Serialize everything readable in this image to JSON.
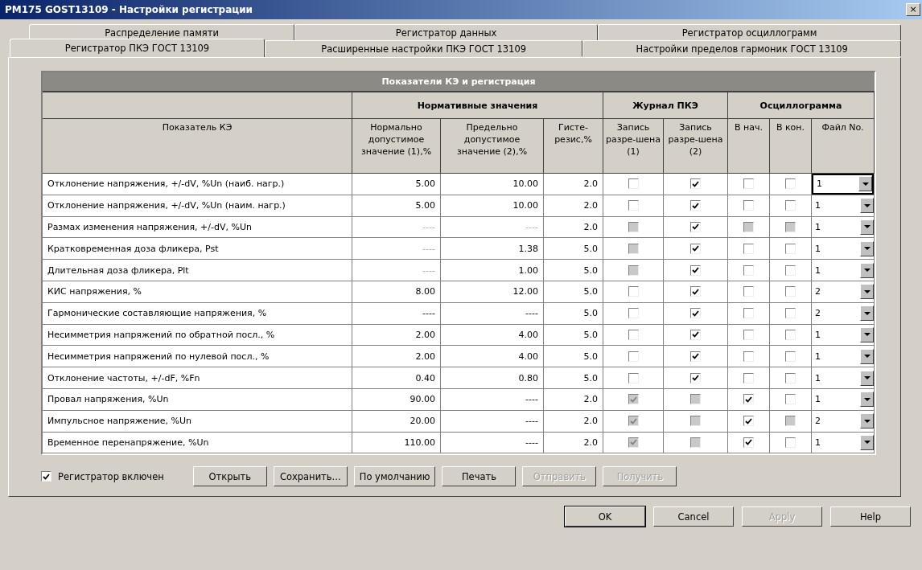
{
  "window": {
    "title": "PM175 GOST13109 - Настройки регистрации",
    "close": "×"
  },
  "tabs_back": [
    {
      "label": "Распределение памяти",
      "selected": false
    },
    {
      "label": "Регистратор данных",
      "selected": false
    },
    {
      "label": "Регистратор осциллограмм",
      "selected": false
    }
  ],
  "tabs_front": [
    {
      "label": "Регистратор ПКЭ ГОСТ 13109",
      "selected": true
    },
    {
      "label": "Расширенные настройки ПКЭ ГОСТ 13109",
      "selected": false
    },
    {
      "label": "Настройки пределов гармоник ГОСТ 13109",
      "selected": false
    }
  ],
  "table": {
    "title": "Показатели КЭ и регистрация",
    "groups": [
      "Нормативные значения",
      "Журнал ПКЭ",
      "Осциллограмма"
    ],
    "columns": [
      "Показатель КЭ",
      "Нормально допустимое значение (1),%",
      "Предельно допустимое значение (2),%",
      "Гисте-резис,%",
      "Запись разре-шена (1)",
      "Запись разре-шена (2)",
      "В нач.",
      "В кон.",
      "Файл No."
    ],
    "rows": [
      {
        "name": "Отклонение напряжения, +/-dV, %Un (наиб. нагр.)",
        "normal": {
          "text": "5.00",
          "disabled": false
        },
        "limit": {
          "text": "10.00",
          "disabled": false
        },
        "hyst": "2.0",
        "checks": [
          {
            "checked": false,
            "disabled": false
          },
          {
            "checked": true,
            "disabled": false
          },
          {
            "checked": false,
            "disabled": false
          },
          {
            "checked": false,
            "disabled": false
          }
        ],
        "file": "1",
        "focused": true
      },
      {
        "name": "Отклонение напряжения, +/-dV, %Un (наим. нагр.)",
        "normal": {
          "text": "5.00",
          "disabled": false
        },
        "limit": {
          "text": "10.00",
          "disabled": false
        },
        "hyst": "2.0",
        "checks": [
          {
            "checked": false,
            "disabled": false
          },
          {
            "checked": true,
            "disabled": false
          },
          {
            "checked": false,
            "disabled": false
          },
          {
            "checked": false,
            "disabled": false
          }
        ],
        "file": "1",
        "focused": false
      },
      {
        "name": "Размах изменения напряжения, +/-dV, %Un",
        "normal": {
          "text": "----",
          "disabled": true
        },
        "limit": {
          "text": "----",
          "disabled": true
        },
        "hyst": "2.0",
        "checks": [
          {
            "checked": false,
            "disabled": true
          },
          {
            "checked": true,
            "disabled": false
          },
          {
            "checked": false,
            "disabled": true
          },
          {
            "checked": false,
            "disabled": true
          }
        ],
        "file": "1",
        "focused": false
      },
      {
        "name": "Кратковременная доза фликера, Pst",
        "normal": {
          "text": "----",
          "disabled": true
        },
        "limit": {
          "text": "1.38",
          "disabled": false
        },
        "hyst": "5.0",
        "checks": [
          {
            "checked": false,
            "disabled": true
          },
          {
            "checked": true,
            "disabled": false
          },
          {
            "checked": false,
            "disabled": false
          },
          {
            "checked": false,
            "disabled": false
          }
        ],
        "file": "1",
        "focused": false
      },
      {
        "name": "Длительная доза фликера, Plt",
        "normal": {
          "text": "----",
          "disabled": true
        },
        "limit": {
          "text": "1.00",
          "disabled": false
        },
        "hyst": "5.0",
        "checks": [
          {
            "checked": false,
            "disabled": true
          },
          {
            "checked": true,
            "disabled": false
          },
          {
            "checked": false,
            "disabled": false
          },
          {
            "checked": false,
            "disabled": false
          }
        ],
        "file": "1",
        "focused": false
      },
      {
        "name": "КИС напряжения, %",
        "normal": {
          "text": "8.00",
          "disabled": false
        },
        "limit": {
          "text": "12.00",
          "disabled": false
        },
        "hyst": "5.0",
        "checks": [
          {
            "checked": false,
            "disabled": false
          },
          {
            "checked": true,
            "disabled": false
          },
          {
            "checked": false,
            "disabled": false
          },
          {
            "checked": false,
            "disabled": false
          }
        ],
        "file": "2",
        "focused": false
      },
      {
        "name": "Гармонические составляющие напряжения, %",
        "normal": {
          "text": "----",
          "disabled": false
        },
        "limit": {
          "text": "----",
          "disabled": false
        },
        "hyst": "5.0",
        "checks": [
          {
            "checked": false,
            "disabled": false
          },
          {
            "checked": true,
            "disabled": false
          },
          {
            "checked": false,
            "disabled": false
          },
          {
            "checked": false,
            "disabled": false
          }
        ],
        "file": "2",
        "focused": false
      },
      {
        "name": "Несимметрия напряжений по обратной посл., %",
        "normal": {
          "text": "2.00",
          "disabled": false
        },
        "limit": {
          "text": "4.00",
          "disabled": false
        },
        "hyst": "5.0",
        "checks": [
          {
            "checked": false,
            "disabled": false
          },
          {
            "checked": true,
            "disabled": false
          },
          {
            "checked": false,
            "disabled": false
          },
          {
            "checked": false,
            "disabled": false
          }
        ],
        "file": "1",
        "focused": false
      },
      {
        "name": "Несимметрия напряжений по нулевой посл., %",
        "normal": {
          "text": "2.00",
          "disabled": false
        },
        "limit": {
          "text": "4.00",
          "disabled": false
        },
        "hyst": "5.0",
        "checks": [
          {
            "checked": false,
            "disabled": false
          },
          {
            "checked": true,
            "disabled": false
          },
          {
            "checked": false,
            "disabled": false
          },
          {
            "checked": false,
            "disabled": false
          }
        ],
        "file": "1",
        "focused": false
      },
      {
        "name": "Отклонение частоты, +/-dF, %Fn",
        "normal": {
          "text": "0.40",
          "disabled": false
        },
        "limit": {
          "text": "0.80",
          "disabled": false
        },
        "hyst": "5.0",
        "checks": [
          {
            "checked": false,
            "disabled": false
          },
          {
            "checked": true,
            "disabled": false
          },
          {
            "checked": false,
            "disabled": false
          },
          {
            "checked": false,
            "disabled": false
          }
        ],
        "file": "1",
        "focused": false
      },
      {
        "name": "Провал напряжения, %Un",
        "normal": {
          "text": "90.00",
          "disabled": false
        },
        "limit": {
          "text": "----",
          "disabled": false
        },
        "hyst": "2.0",
        "checks": [
          {
            "checked": true,
            "disabled": true
          },
          {
            "checked": false,
            "disabled": true
          },
          {
            "checked": true,
            "disabled": false
          },
          {
            "checked": false,
            "disabled": false
          }
        ],
        "file": "1",
        "focused": false
      },
      {
        "name": "Импульсное напряжение, %Un",
        "normal": {
          "text": "20.00",
          "disabled": false
        },
        "limit": {
          "text": "----",
          "disabled": false
        },
        "hyst": "2.0",
        "checks": [
          {
            "checked": true,
            "disabled": true
          },
          {
            "checked": false,
            "disabled": true
          },
          {
            "checked": true,
            "disabled": false
          },
          {
            "checked": false,
            "disabled": true
          }
        ],
        "file": "2",
        "focused": false
      },
      {
        "name": "Временное перенапряжение, %Un",
        "normal": {
          "text": "110.00",
          "disabled": false
        },
        "limit": {
          "text": "----",
          "disabled": false
        },
        "hyst": "2.0",
        "checks": [
          {
            "checked": true,
            "disabled": true
          },
          {
            "checked": false,
            "disabled": true
          },
          {
            "checked": true,
            "disabled": false
          },
          {
            "checked": false,
            "disabled": false
          }
        ],
        "file": "1",
        "focused": false
      }
    ]
  },
  "enabled": {
    "label": "Регистратор включен",
    "checked": true
  },
  "actions": [
    {
      "label": "Открыть",
      "disabled": false
    },
    {
      "label": "Сохранить...",
      "disabled": false
    },
    {
      "label": "По умолчанию",
      "disabled": false
    },
    {
      "label": "Печать",
      "disabled": false
    },
    {
      "label": "Отправить",
      "disabled": true
    },
    {
      "label": "Получить",
      "disabled": true
    }
  ],
  "dialog_buttons": [
    {
      "label": "OK",
      "disabled": false,
      "default": true
    },
    {
      "label": "Cancel",
      "disabled": false,
      "default": false
    },
    {
      "label": "Apply",
      "disabled": true,
      "default": false
    },
    {
      "label": "Help",
      "disabled": false,
      "default": false
    }
  ]
}
